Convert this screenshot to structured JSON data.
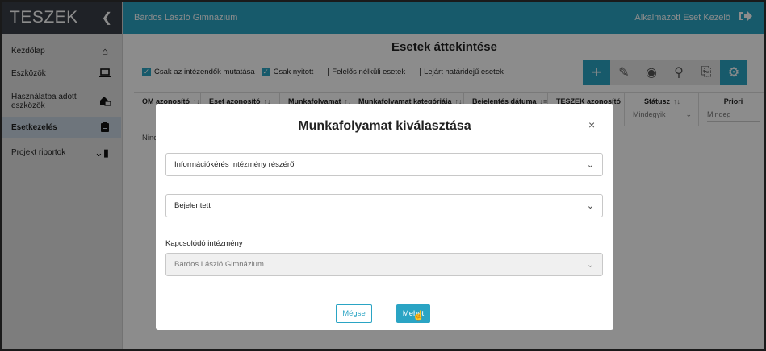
{
  "sidebar": {
    "brand": "TESZEK",
    "items": [
      {
        "label": "Kezdőlap",
        "icon": "home-icon"
      },
      {
        "label": "Eszközök",
        "icon": "laptop-icon"
      },
      {
        "label": "Használatba adott eszközök",
        "icon": "house-laptop-icon"
      },
      {
        "label": "Esetkezelés",
        "icon": "clipboard-icon",
        "active": true
      },
      {
        "label": "Projekt riportok",
        "icon": "scroll-icon"
      }
    ]
  },
  "topbar": {
    "institution": "Bárdos László Gimnázium",
    "user_role": "Alkalmazott Eset Kezelő"
  },
  "main": {
    "title": "Esetek áttekintése",
    "filters": [
      {
        "label": "Csak az intézendők mutatása",
        "checked": true
      },
      {
        "label": "Csak nyitott",
        "checked": true
      },
      {
        "label": "Felelős nélküli esetek",
        "checked": false
      },
      {
        "label": "Lejárt határidejű esetek",
        "checked": false
      }
    ],
    "columns": [
      {
        "label": "OM azonosító"
      },
      {
        "label": "Eset azonosító"
      },
      {
        "label": "Munkafolyamat"
      },
      {
        "label": "Munkafolyamat kategóriája"
      },
      {
        "label": "Bejelentés dátuma"
      },
      {
        "label": "TESZEK azonosító"
      },
      {
        "label": "Státusz",
        "filter": "Mindegyik"
      },
      {
        "label": "Priori",
        "filter": "Mindeg"
      }
    ],
    "empty_text": "Ninc"
  },
  "modal": {
    "title": "Munkafolyamat kiválasztása",
    "close": "×",
    "workflow_value": "Információkérés Intézmény részéről",
    "status_value": "Bejelentett",
    "institution_label": "Kapcsolódó intézmény",
    "institution_value": "Bárdos László Gimnázium",
    "cancel_label": "Mégse",
    "save_label": "Mehet"
  },
  "colors": {
    "accent": "#2aa4c4",
    "brand_bg": "#3a3f47",
    "sidebar_bg": "#e4e4e4"
  }
}
